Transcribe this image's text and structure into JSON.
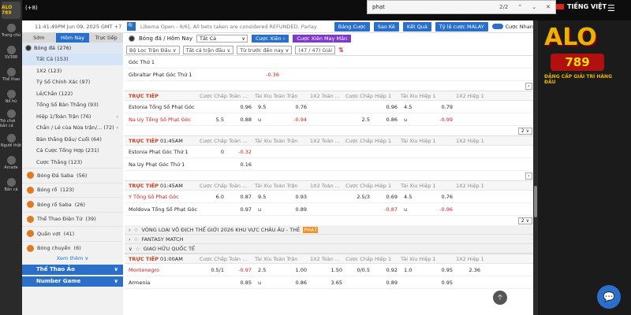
{
  "topbar": {
    "plus_label": "(+8)",
    "find_query": "phạt",
    "find_count": "2/2",
    "find_up": "⌃",
    "find_down": "⌄",
    "find_close": "✕",
    "language": "TIẾNG VIỆT",
    "menu": "☰"
  },
  "brand": {
    "alo": "ALO",
    "num": "789",
    "tagline": "ĐẲNG CẤP GIẢI TRÍ HÀNG ĐẦU"
  },
  "rail": {
    "logo": "ALO 789",
    "items": [
      "Trang chủ",
      "SV388",
      "Thể thao",
      "Nổ hũ",
      "Trò chơi bắn cá",
      "Người thật",
      "Arcade",
      "Bắn cá"
    ]
  },
  "header": {
    "time": "11:41:49PM Jun 09, 2025 GMT +7",
    "search": "🔍",
    "marquee": "Libema Open - 9/6]. All bets taken are considered REFUNDED. Parlay",
    "buttons": [
      "Bảng Cược",
      "Sao Kê",
      "Kết Quả",
      "Tỷ lệ cược MALAY"
    ],
    "chk1": "Cược Nhanh",
    "chk2": "Chế độ xem"
  },
  "sidebar": {
    "tabs": [
      "Sớm",
      "Hôm Nay",
      "Trực tiếp"
    ],
    "football": {
      "label": "Bóng đá",
      "count": "(276)"
    },
    "subs": [
      {
        "label": "Tất Cả",
        "count": "(153)",
        "sel": true
      },
      {
        "label": "1X2",
        "count": "(123)"
      },
      {
        "label": "Tỷ Số Chính Xác",
        "count": "(97)"
      },
      {
        "label": "Lẻ/Chẵn",
        "count": "(122)"
      },
      {
        "label": "Tổng Số Bàn Thắng",
        "count": "(93)"
      },
      {
        "label": "Hiệp 1/Toàn Trận",
        "count": "(76)",
        "arr": "‹"
      },
      {
        "label": "Chẵn / Lẻ của Nửa trận/...",
        "count": "(72)",
        "arr": "‹"
      },
      {
        "label": "Bàn thắng Đầu/ Cuối",
        "count": "(64)"
      },
      {
        "label": "Cá Cược Tổng Hợp",
        "count": "(231)"
      },
      {
        "label": "Cược Thắng",
        "count": "(123)"
      }
    ],
    "sports": [
      {
        "label": "Bóng Đá Saba",
        "count": "(56)"
      },
      {
        "label": "Bóng rổ",
        "count": "(123)"
      },
      {
        "label": "Bóng rổ Saba",
        "count": "(26)"
      },
      {
        "label": "Thể Thao Điện Tử",
        "count": "(39)"
      },
      {
        "label": "Quần vợt",
        "count": "(41)"
      },
      {
        "label": "Bóng chuyền",
        "count": "(6)"
      }
    ],
    "more": "Xem thêm ∨",
    "cats": [
      "Thể Thao Ảo",
      "Number Game"
    ]
  },
  "content": {
    "title_sport": "Bóng đá / Hôm Nay",
    "all_sel": "Tất Cả",
    "btn1": "Cược Xiên ›",
    "btn2": "Cược Xiên May Mắn",
    "filters": [
      "Bộ Lọc Trận Đấu ∨",
      "Tất cả trận đấu ∨",
      "Từ trước đến nay ∨"
    ],
    "pages": "(47 / 47) Giải",
    "sort": "⇅",
    "live": "TRỰC TIẾP",
    "headers": [
      "Cược Chấp Toàn ...",
      "Tài Xỉu Toàn Trận",
      "1X2 Toàn ...",
      "Cược Chấp Hiệp 1",
      "Tài Xỉu Hiệp 1",
      "1X2 Hiệp 1"
    ],
    "m0": {
      "team1": "Góc Thứ 1",
      "team2": "Gibraltar Phạt Góc Thứ 1",
      "v": [
        "",
        "-0.36"
      ]
    },
    "m1": {
      "time": "01:45AM",
      "t1": "Estonia Tổng Số Phạt Góc",
      "t2": "Na Uy Tổng Số Phạt Góc",
      "r1": [
        "",
        "0.96",
        "9.5",
        "0.76",
        "",
        "",
        "0.96",
        "4.5",
        "0.79"
      ],
      "r2": [
        "5.5",
        "0.88",
        "u",
        "-0.94",
        "",
        "2.5",
        "0.86",
        "u",
        "-0.99"
      ],
      "pager": "2 ∨"
    },
    "m2": {
      "time": "01:45AM",
      "t1": "Estonia Phạt Góc Thứ 1",
      "t2": "Na Uy Phạt Góc Thứ 1",
      "r1": [
        "0",
        "-0.32"
      ],
      "r2": [
        "",
        "0.16"
      ]
    },
    "m3": {
      "time": "01:45AM",
      "t1": "Y Tổng Số Phạt Góc",
      "t2": "Moldova Tổng Số Phạt Góc",
      "r1": [
        "6.0",
        "0.87",
        "9.5",
        "0.93",
        "",
        "2.5/3",
        "0.69",
        "4.5",
        "0.76"
      ],
      "r2": [
        "",
        "0.97",
        "u",
        "0.89",
        "",
        "",
        "-0.87",
        "u",
        "-0.96"
      ],
      "pager": "2 ∨"
    },
    "leagues": [
      {
        "pre": "VÒNG LOẠI VÔ ĐỊCH THẾ GIỚI 2026 KHU VỰC CHÂU ÂU - THẺ",
        "hl": "PHẠT"
      },
      {
        "pre": "FANTASY MATCH",
        "hl": ""
      },
      {
        "pre": "GIAO HỮU QUỐC TẾ",
        "hl": ""
      }
    ],
    "m4": {
      "time": "01:00AM",
      "t1": "Montenegro",
      "t2": "Armenia",
      "r1": [
        "0.5/1",
        "-0.97",
        "2.5",
        "1.00",
        "1.50",
        "0/0.5",
        "0.92",
        "1.0",
        "0.95",
        "2.36"
      ],
      "r2": [
        "",
        "0.85",
        "u",
        "0.86",
        "3.65",
        "",
        "0.89",
        "",
        "0.95",
        ""
      ]
    }
  },
  "widgets": {
    "top": "🡡",
    "chat": "💬"
  }
}
